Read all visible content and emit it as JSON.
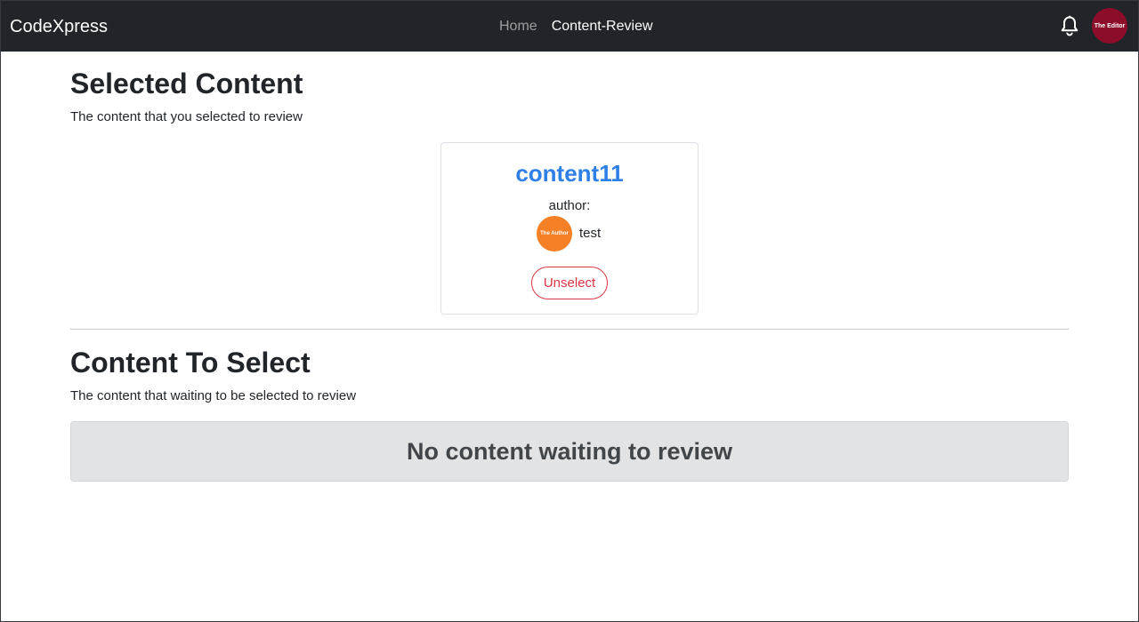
{
  "navbar": {
    "brand": "CodeXpress",
    "links": [
      {
        "label": "Home",
        "active": false
      },
      {
        "label": "Content-Review",
        "active": true
      }
    ],
    "bell_icon": "bell-icon",
    "user_avatar_text": "The Editor"
  },
  "selected": {
    "title": "Selected Content",
    "subtitle": "The content that you selected to review",
    "card": {
      "content_title": "content11",
      "author_label": "author:",
      "author_avatar_text": "The Author",
      "author_name": "test",
      "unselect_label": "Unselect"
    }
  },
  "to_select": {
    "title": "Content To Select",
    "subtitle": "The content that waiting to be selected to review",
    "empty_message": "No content waiting to review"
  },
  "colors": {
    "navbar_bg": "#212529",
    "link_blue": "#2e7fe6",
    "danger": "#dc3545",
    "editor_avatar": "#8b0d2a",
    "author_avatar": "#f58026",
    "empty_bg": "#e2e3e5"
  }
}
